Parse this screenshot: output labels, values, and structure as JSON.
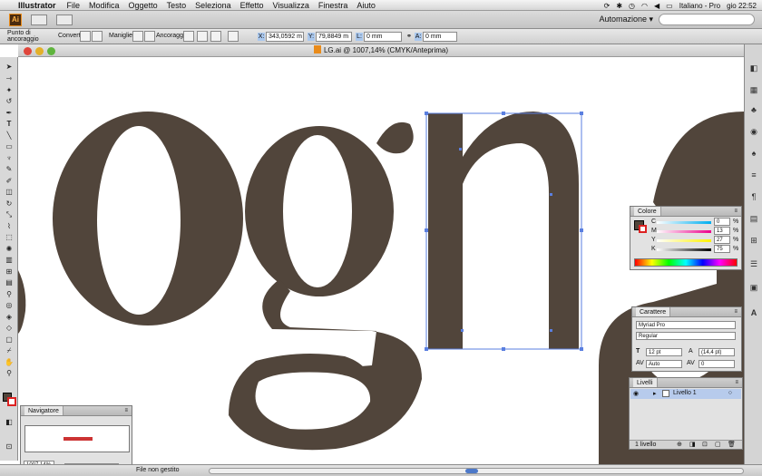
{
  "menubar": {
    "app_name": "Illustrator",
    "items": [
      "File",
      "Modifica",
      "Oggetto",
      "Testo",
      "Seleziona",
      "Effetto",
      "Visualizza",
      "Finestra",
      "Aiuto"
    ],
    "language": "Italiano - Pro",
    "clock": "gio 22:52"
  },
  "appbar": {
    "logo": "Ai",
    "workspace": "Automazione ▾"
  },
  "control": {
    "anchor_label_1": "Punto di",
    "anchor_label_2": "ancoraggio",
    "converti": "Converti:",
    "maniglie": "Maniglie:",
    "ancoraggi": "Ancoraggi:",
    "x_label": "X:",
    "x_value": "343,0592 m",
    "y_label": "Y:",
    "y_value": "79,8849 m",
    "l_label": "L:",
    "l_value": "0 mm",
    "a_label": "A:",
    "a_value": "0 mm"
  },
  "document": {
    "title": "LG.ai @ 1007,14% (CMYK/Anteprima)",
    "text_glyphs": "ogna"
  },
  "colors": {
    "glyph_fill": "#51453b",
    "selection": "#5a7fe0"
  },
  "color_panel": {
    "tab": "Colore",
    "channels": [
      {
        "label": "C",
        "value": "0"
      },
      {
        "label": "M",
        "value": "13"
      },
      {
        "label": "Y",
        "value": "27"
      },
      {
        "label": "K",
        "value": "75"
      }
    ],
    "unit": "%"
  },
  "character_panel": {
    "tab": "Carattere",
    "font_family": "Myriad Pro",
    "font_style": "Regular",
    "size": "12 pt",
    "leading": "(14,4 pt)",
    "kerning": "Auto",
    "tracking": "0"
  },
  "layers_panel": {
    "tab": "Livelli",
    "layer_name": "Livello 1",
    "footer": "1 livello"
  },
  "navigator": {
    "tab": "Navigatore",
    "zoom": "1007,14%"
  },
  "status": {
    "zoom": "1007,14%",
    "state": "File non gestito"
  }
}
